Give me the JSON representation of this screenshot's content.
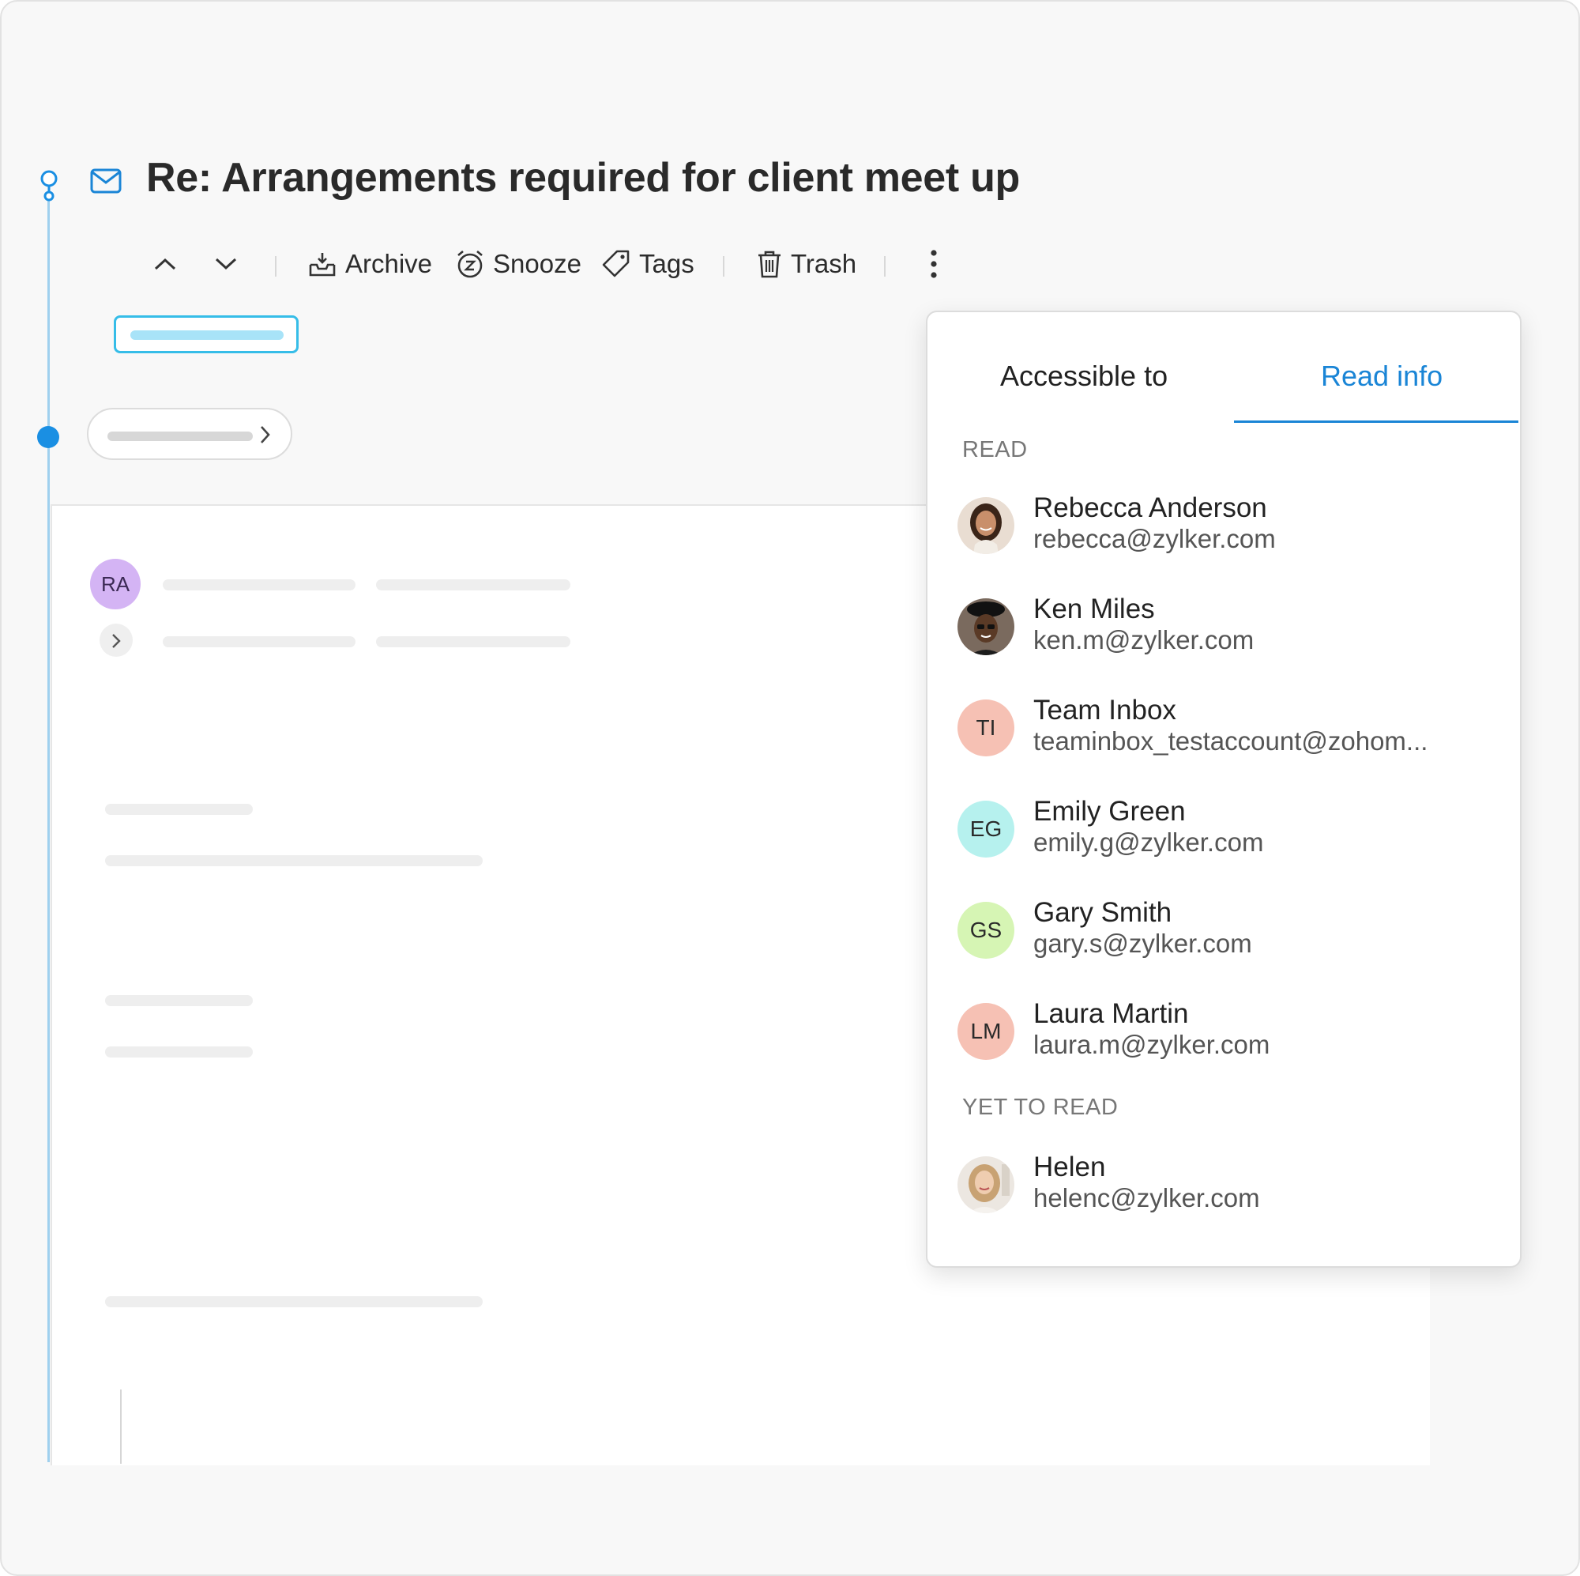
{
  "thread": {
    "subject": "Re: Arrangements required for client meet up"
  },
  "toolbar": {
    "archive_label": "Archive",
    "snooze_label": "Snooze",
    "tags_label": "Tags",
    "trash_label": "Trash"
  },
  "message": {
    "sender_initials": "RA",
    "avatar_color": "#d4b4f4"
  },
  "popover": {
    "tabs": [
      {
        "label": "Accessible to",
        "active": false
      },
      {
        "label": "Read info",
        "active": true
      }
    ],
    "accent_color": "#1a85d6",
    "read_heading": "READ",
    "yet_to_read_heading": "YET TO READ",
    "read": [
      {
        "name": "Rebecca Anderson",
        "email": "rebecca@zylker.com",
        "avatar": "photo"
      },
      {
        "name": "Ken Miles",
        "email": "ken.m@zylker.com",
        "avatar": "photo"
      },
      {
        "name": "Team Inbox",
        "email": "teaminbox_testaccount@zohom...",
        "initials": "TI",
        "color": "#f6c1b4"
      },
      {
        "name": "Emily Green",
        "email": "emily.g@zylker.com",
        "initials": "EG",
        "color": "#b6f1ee"
      },
      {
        "name": "Gary Smith",
        "email": "gary.s@zylker.com",
        "initials": "GS",
        "color": "#d6f5b4"
      },
      {
        "name": "Laura Martin",
        "email": "laura.m@zylker.com",
        "initials": "LM",
        "color": "#f6c1b4"
      }
    ],
    "yet_to_read": [
      {
        "name": "Helen",
        "email": "helenc@zylker.com",
        "avatar": "photo"
      }
    ]
  }
}
